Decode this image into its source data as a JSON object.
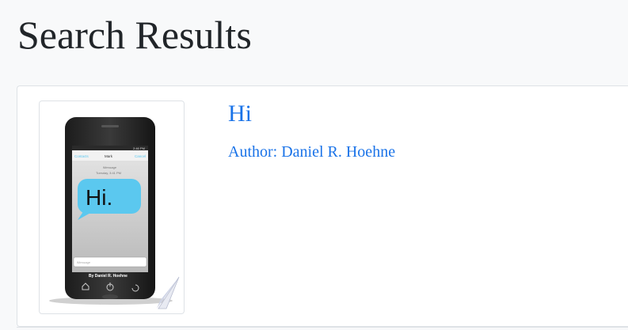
{
  "page": {
    "title": "Search Results"
  },
  "results": [
    {
      "title": "Hi",
      "author": "Author: Daniel R. Hoehne",
      "cover": {
        "status_time": "2:46 PM",
        "back_label": "Contacts",
        "contact_label": "Mark",
        "edit_label": "Cancel",
        "message_label": "iMessage",
        "date_label": "Tuesday, 3:41 PM",
        "bubble_text": "Hi.",
        "input_placeholder": "iMessage",
        "byline": "By Daniel R. Hoehne",
        "bubble_color": "#5bc8ef"
      }
    }
  ],
  "colors": {
    "link": "#1a73e8",
    "heading": "#212529",
    "background": "#f8f9fa",
    "card_border": "#dee2e6"
  }
}
